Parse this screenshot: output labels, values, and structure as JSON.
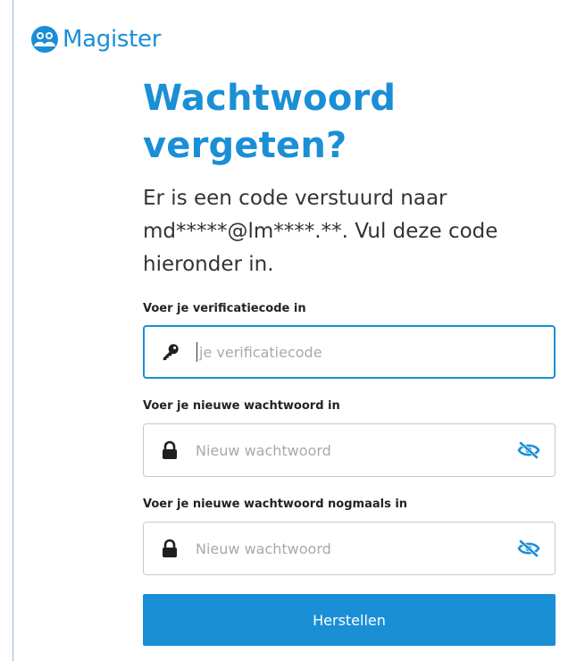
{
  "brand": {
    "name": "Magister",
    "accent": "#1a8fd6"
  },
  "title": "Wachtwoord vergeten?",
  "message": "Er is een code verstuurd naar md*****@lm****.**. Vul deze code hieronder in.",
  "fields": [
    {
      "label": "Voer je verificatiecode in",
      "placeholder": "je verificatiecode",
      "value": "",
      "icon": "key-icon",
      "focused": true
    },
    {
      "label": "Voer je nieuwe wachtwoord in",
      "placeholder": "Nieuw wachtwoord",
      "value": "",
      "icon": "lock-icon",
      "toggle_icon": "eye-slash-icon"
    },
    {
      "label": "Voer je nieuwe wachtwoord nogmaals in",
      "placeholder": "Nieuw wachtwoord",
      "value": "",
      "icon": "lock-icon",
      "toggle_icon": "eye-slash-icon"
    }
  ],
  "submit_label": "Herstellen"
}
